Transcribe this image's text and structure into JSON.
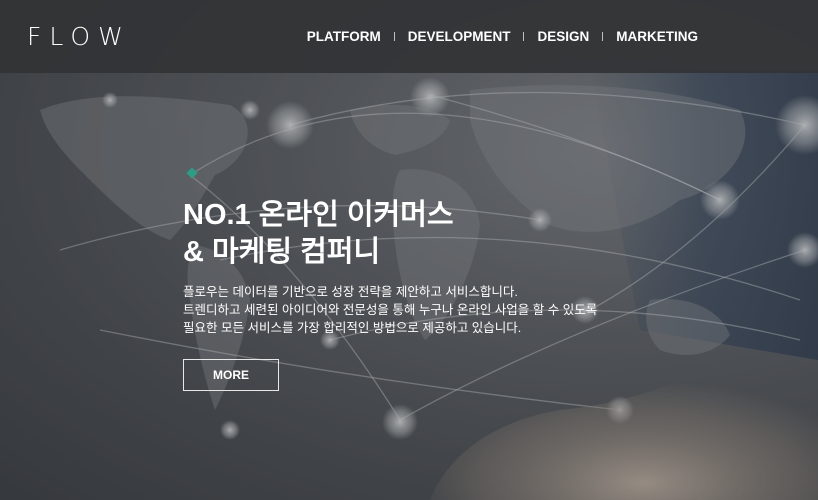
{
  "header": {
    "logo": "FLOW",
    "nav": [
      "PLATFORM",
      "DEVELOPMENT",
      "DESIGN",
      "MARKETING"
    ]
  },
  "hero": {
    "headline_line1": "NO.1 온라인 이커머스",
    "headline_line2": "& 마케팅 컴퍼니",
    "desc_line1": "플로우는 데이터를 기반으로 성장 전략을 제안하고 서비스합니다.",
    "desc_line2": "트렌디하고 세련된 아이디어와 전문성을 통해 누구나 온라인 사업을 할 수 있도록",
    "desc_line3": "필요한 모든 서비스를 가장 합리적인 방법으로 제공하고 있습니다.",
    "button": "MORE"
  },
  "colors": {
    "header_bg": "#323335",
    "accent_dot": "#2e9b86",
    "text": "#ffffff"
  }
}
